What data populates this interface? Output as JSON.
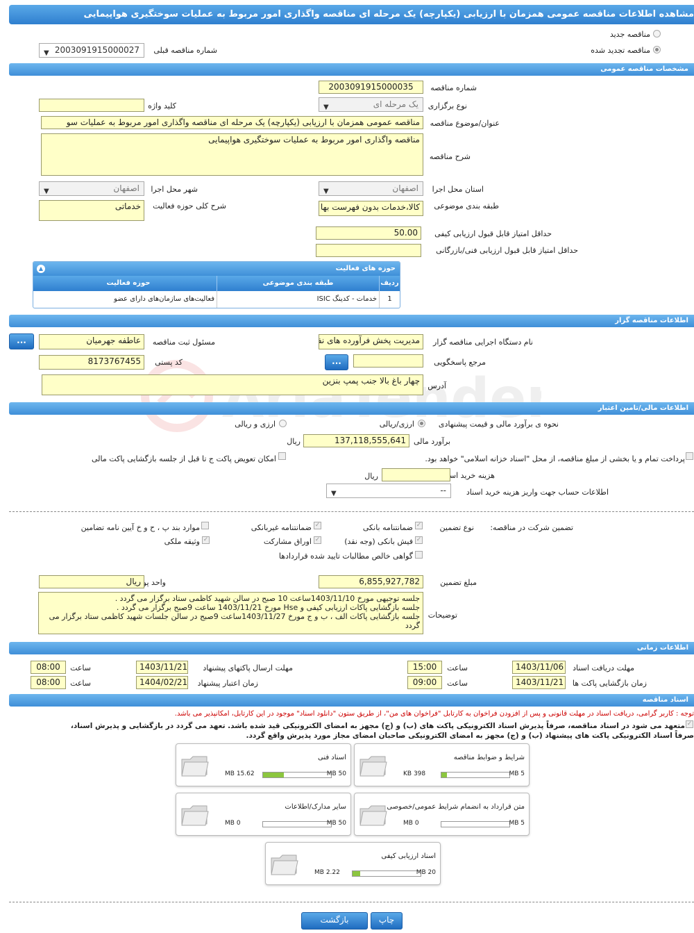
{
  "title": "مشاهده اطلاعات مناقصه عمومی همزمان با ارزیابی (یکپارچه) یک مرحله ای مناقصه واگذاری امور مربوط به عملیات سوختگیری هواپیمایی",
  "top": {
    "new_tender": "مناقصه جدید",
    "renewed_tender": "مناقصه تجدید شده",
    "prev_number_label": "شماره مناقصه قبلی",
    "prev_number": "2003091915000027"
  },
  "general": {
    "header": "مشخصات مناقصه عمومی",
    "number_label": "شماره مناقصه",
    "number": "2003091915000035",
    "hold_type_label": "نوع برگزاری",
    "hold_type": "یک مرحله ای",
    "keyword_label": "کلید واژه",
    "keyword": "",
    "subject_label": "عنوان/موضوع مناقصه",
    "subject": "مناقصه عمومی همزمان با ارزیابی (یکپارچه) یک مرحله ای مناقصه واگذاری امور مربوط به عملیات سو",
    "desc_label": "شرح مناقصه",
    "desc": "مناقصه واگذاری امور مربوط به عملیات سوختگیری هواپیمایی",
    "province_label": "استان محل اجرا",
    "province": "اصفهان",
    "city_label": "شهر محل اجرا",
    "city": "اصفهان",
    "category_label": "طبقه بندی موضوعی",
    "category": "کالا،خدمات بدون فهرست بها",
    "activity_desc_label": "شرح کلی حوزه فعالیت",
    "activity_desc": "خدماتی",
    "min_quality_label": "حداقل امتیاز قابل قبول ارزیابی کیفی",
    "min_quality": "50.00",
    "min_tech_label": "حداقل امتیاز قابل قبول ارزیابی فنی/بازرگانی",
    "min_tech": ""
  },
  "activities": {
    "header": "حوزه های فعالیت",
    "col_row": "ردیف",
    "col_cat": "طبقه بندی موضوعی",
    "col_field": "حوزه فعالیت",
    "rows": [
      {
        "row": "1",
        "cat": "خدمات - کدینگ ISIC",
        "field": "فعالیت‌های سازمان‌های دارای عضو"
      }
    ]
  },
  "org": {
    "header": "اطلاعات مناقصه گزار",
    "device_label": "نام دستگاه اجرایی مناقصه گزار",
    "device": "مدیریت پخش فرآورده های نفتی",
    "registrar_label": "مسئول ثبت مناقصه",
    "registrar": "عاطفه جهرمیان",
    "ref_label": "مرجع پاسخگویی",
    "ref": "",
    "postal_label": "کد پستی",
    "postal": "8173767455",
    "address_label": "آدرس",
    "address": "چهار باغ بالا جنب پمپ بنزین",
    "btn": "..."
  },
  "finance": {
    "header": "اطلاعات مالی/تامین اعتبار",
    "estimate_method_label": "نحوه ی برآورد مالی و قیمت پیشنهادی",
    "opt_rial": "ارزی/ریالی",
    "opt_fx": "ارزی و ریالی",
    "estimate_label": "برآورد مالی",
    "estimate": "137,118,555,641",
    "rial": "ریال",
    "treasury_note": "پرداخت تمام و یا بخشی از مبلغ مناقصه، از محل \"اسناد خزانه اسلامی\" خواهد بود.",
    "swap_note": "امکان تعویض پاکت ج تا قبل از جلسه بازگشایی پاکت مالی",
    "doc_fee_label": "هزینه خرید اسناد",
    "doc_fee": "",
    "account_label": "اطلاعات حساب جهت واریز هزینه خرید اسناد",
    "account": "--"
  },
  "guarantee": {
    "participation_label": "تضمین شرکت در مناقصه:",
    "type_label": "نوع تضمین",
    "items": {
      "bank": "ضمانتنامه بانکی",
      "nonbank": "ضمانتنامه غیربانکی",
      "rules": "موارد بند پ ، ح و خ آیین نامه تضامین",
      "cheque": "فیش بانکی (وجه نقد)",
      "bonds": "اوراق مشارکت",
      "property": "وثیقه ملکی",
      "claims": "گواهی خالص مطالبات تایید شده قراردادها"
    },
    "amount_label": "مبلغ تضمین",
    "amount": "6,855,927,782",
    "currency_label": "واحد پول",
    "currency": "ریال",
    "notes_label": "توضیحات",
    "notes1": "جلسه توجیهی مورخ 1403/11/10ساعت 10 صبح در سالن شهید کاظمی ستاد برگزار می گردد .",
    "notes2": "جلسه بازگشایی پاکات ارزیابی کیفی و Hse مورخ 1403/11/21 ساعت 9صبح برگزار می گردد .",
    "notes3": "جلسه بازگشایی پاکات الف ، ب و ج مورخ 1403/11/27ساعت 9صبح در سالن جلسات شهید کاظمی ستاد برگزار می گردد"
  },
  "timing": {
    "header": "اطلاعات زمانی",
    "doc_receive_label": "مهلت دریافت اسناد",
    "doc_receive_date": "1403/11/06",
    "time_label": "ساعت",
    "doc_receive_time": "15:00",
    "send_label": "مهلت ارسال پاکتهای پیشنهاد",
    "send_date": "1403/11/21",
    "send_time": "08:00",
    "open_label": "زمان بازگشایی پاکت ها",
    "open_date": "1403/11/21",
    "open_time": "09:00",
    "validity_label": "زمان اعتبار پیشنهاد",
    "validity_date": "1404/02/21",
    "validity_time": "08:00"
  },
  "docs": {
    "header": "اسناد مناقصه",
    "warn_prefix": "توجه :",
    "warn": "کاربر گرامی، دریافت اسناد در مهلت قانونی و پس از افزودن فراخوان به کارتابل \"فراخوان های من\"، از طریق ستون \"دانلود اسناد\" موجود در این کارتابل، امکانپذیر می باشد.",
    "commit1": "متعهد می شود در اسناد مناقصه، صرفاً پذیرش اسناد الکترونیکی پاکت های (ب) و (ج) مجهز به امضای الکترونیکی قید شده باشد. تعهد می گردد در بازگشایی و پذیرش اسناد،",
    "commit2": "صرفاً اسناد الکترونیکی پاکت های پیشنهاد (ب) و (ج) مجهز به امضای الکترونیکی صاحبان امضای مجاز مورد پذیرش واقع گردد.",
    "files": [
      {
        "name": "شرایط و ضوابط مناقصه",
        "used": "398 KB",
        "max": "5 MB",
        "pct": 0.08
      },
      {
        "name": "اسناد فنی",
        "used": "15.62 MB",
        "max": "50 MB",
        "pct": 0.31
      },
      {
        "name": "متن قرارداد به انضمام شرایط عمومی/خصوصی",
        "used": "0 MB",
        "max": "5 MB",
        "pct": 0
      },
      {
        "name": "سایر مدارک/اطلاعات",
        "used": "0 MB",
        "max": "50 MB",
        "pct": 0
      },
      {
        "name": "اسناد ارزیابی کیفی",
        "used": "2.22 MB",
        "max": "20 MB",
        "pct": 0.11
      }
    ]
  },
  "footer": {
    "print": "چاپ",
    "back": "بازگشت"
  },
  "watermark": {
    "text": "AriaTender.neT"
  },
  "colors": {
    "header": "#3f8fd8",
    "input_bg": "#ffffc8",
    "progress": "#8cc63f",
    "warning": "#cc0000"
  }
}
